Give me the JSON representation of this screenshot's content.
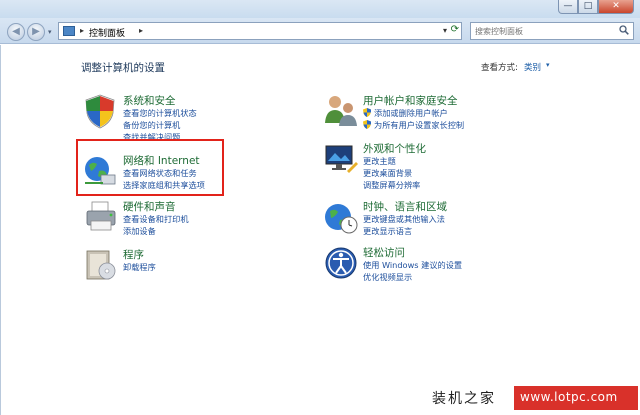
{
  "window": {
    "minimize_label": "—",
    "maximize_label": "□",
    "close_label": "✕"
  },
  "address_bar": {
    "back_label": "◀",
    "forward_label": "▶",
    "recent_label": "▾",
    "separator": "▸",
    "breadcrumb": "控制面板",
    "dropdown_label": "▾",
    "refresh_label": "⟳"
  },
  "search": {
    "placeholder": "搜索控制面板",
    "icon": "search-icon"
  },
  "header": {
    "title": "调整计算机的设置",
    "view_by_label": "查看方式:",
    "view_by_value": "类别",
    "view_by_arrow": "▾"
  },
  "categories": [
    {
      "title": "系统和安全",
      "icon": "shield-icon",
      "links": [
        "查看您的计算机状态",
        "备份您的计算机",
        "查找并解决问题"
      ]
    },
    {
      "title": "网络和 Internet",
      "icon": "network-globe-icon",
      "links": [
        "查看网络状态和任务",
        "选择家庭组和共享选项"
      ]
    },
    {
      "title": "硬件和声音",
      "icon": "printer-icon",
      "links": [
        "查看设备和打印机",
        "添加设备"
      ]
    },
    {
      "title": "程序",
      "icon": "programs-icon",
      "links": [
        "卸载程序"
      ]
    },
    {
      "title": "用户帐户和家庭安全",
      "icon": "users-icon",
      "links": [
        "添加或删除用户帐户",
        "为所有用户设置家长控制"
      ]
    },
    {
      "title": "外观和个性化",
      "icon": "display-icon",
      "links": [
        "更改主题",
        "更改桌面背景",
        "调整屏幕分辨率"
      ]
    },
    {
      "title": "时钟、语言和区域",
      "icon": "clock-globe-icon",
      "links": [
        "更改键盘或其他输入法",
        "更改显示语言"
      ]
    },
    {
      "title": "轻松访问",
      "icon": "accessibility-icon",
      "links": [
        "使用 Windows 建议的设置",
        "优化视频显示"
      ]
    }
  ],
  "watermark": {
    "site_name": "装机之家",
    "url": "www.lotpc.com"
  },
  "colors": {
    "category_title": "#1e6b35",
    "link": "#1e4f9c",
    "highlight_border": "#e2231a",
    "watermark_bg": "#d9312a"
  }
}
